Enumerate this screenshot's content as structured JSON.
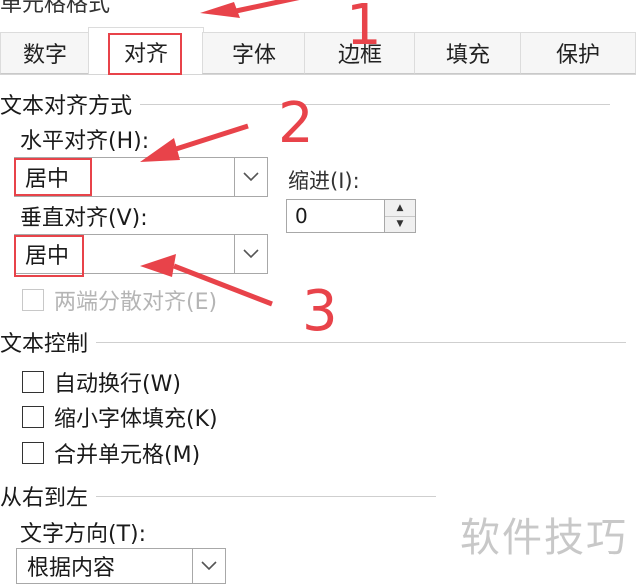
{
  "dialog": {
    "title": "单元格格式"
  },
  "tabs": [
    {
      "label": "数字",
      "active": false
    },
    {
      "label": "对齐",
      "active": true
    },
    {
      "label": "字体",
      "active": false
    },
    {
      "label": "边框",
      "active": false
    },
    {
      "label": "填充",
      "active": false
    },
    {
      "label": "保护",
      "active": false
    }
  ],
  "alignment": {
    "header": "文本对齐方式",
    "horizontal": {
      "label": "水平对齐(H):",
      "value": "居中"
    },
    "indent": {
      "label": "缩进(I):",
      "value": "0"
    },
    "vertical": {
      "label": "垂直对齐(V):",
      "value": "居中"
    },
    "distributed": {
      "label": "两端分散对齐(E)",
      "checked": false,
      "enabled": false
    }
  },
  "text_control": {
    "header": "文本控制",
    "wrap": {
      "label": "自动换行(W)",
      "checked": false
    },
    "shrink": {
      "label": "缩小字体填充(K)",
      "checked": false
    },
    "merge": {
      "label": "合并单元格(M)",
      "checked": false
    }
  },
  "rtl": {
    "header": "从右到左",
    "direction": {
      "label": "文字方向(T):",
      "value": "根据内容"
    }
  },
  "annotations": {
    "step1": "1",
    "step2": "2",
    "step3": "3",
    "color": "#e8434a"
  },
  "watermark": "软件技巧",
  "icons": {
    "dropdown": "chevron-down-icon",
    "spinner_up": "spinner-up-icon",
    "spinner_down": "spinner-down-icon"
  }
}
